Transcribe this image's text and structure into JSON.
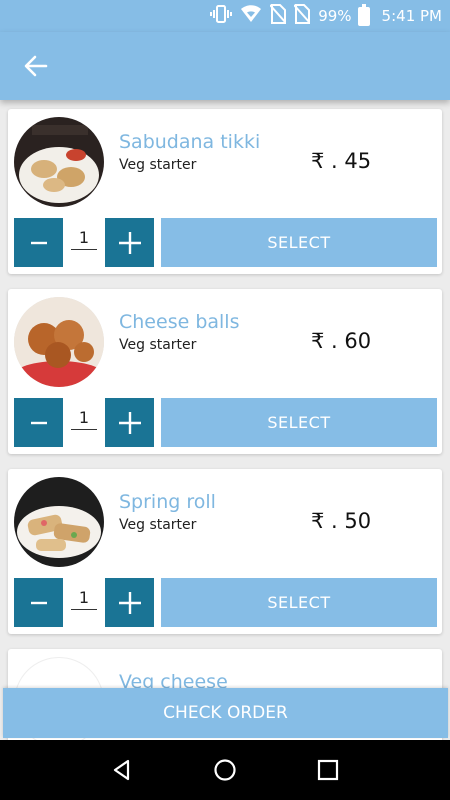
{
  "status_bar": {
    "battery_percent": "99%",
    "time": "5:41 PM",
    "icons": [
      "vibrate-icon",
      "wifi-icon",
      "no-sim-icon",
      "no-sim-icon",
      "battery-icon"
    ]
  },
  "app_bar": {
    "back_icon": "arrow-left-icon"
  },
  "items": [
    {
      "name": "Sabudana tikki",
      "category": "Veg starter",
      "price": "₹ . 45",
      "quantity": "1",
      "select_label": "SELECT",
      "image": "sabudana-tikki-photo"
    },
    {
      "name": "Cheese balls",
      "category": "Veg starter",
      "price": "₹ . 60",
      "quantity": "1",
      "select_label": "SELECT",
      "image": "cheese-balls-photo"
    },
    {
      "name": "Spring roll",
      "category": "Veg starter",
      "price": "₹ . 50",
      "quantity": "1",
      "select_label": "SELECT",
      "image": "spring-roll-photo"
    },
    {
      "name": "Veg cheese",
      "category": "",
      "price": "",
      "quantity": "",
      "select_label": "",
      "image": "veg-cheese-photo"
    }
  ],
  "check_order_label": "CHECK ORDER",
  "colors": {
    "primary": "#86bde6",
    "accent": "#1a7495",
    "item_name": "#7fb7e0",
    "background": "#ececec"
  }
}
